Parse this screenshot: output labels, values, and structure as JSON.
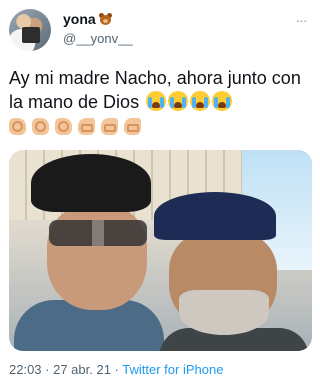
{
  "header": {
    "display_name": "yona",
    "handle": "@__yonv__",
    "more_label": "···"
  },
  "tweet": {
    "text": "Ay mi madre Nacho, ahora junto con la mano de Dios",
    "crying_emoji_count": 4,
    "hand_emojis": [
      "ok-hand",
      "ok-hand",
      "ok-hand",
      "call-me-hand",
      "call-me-hand",
      "call-me-hand"
    ]
  },
  "meta": {
    "time": "22:03",
    "separator": " · ",
    "date": "27 abr. 21",
    "source": "Twitter for iPhone"
  },
  "colors": {
    "text": "#0f1419",
    "muted": "#536471",
    "link": "#1d9bf0"
  }
}
